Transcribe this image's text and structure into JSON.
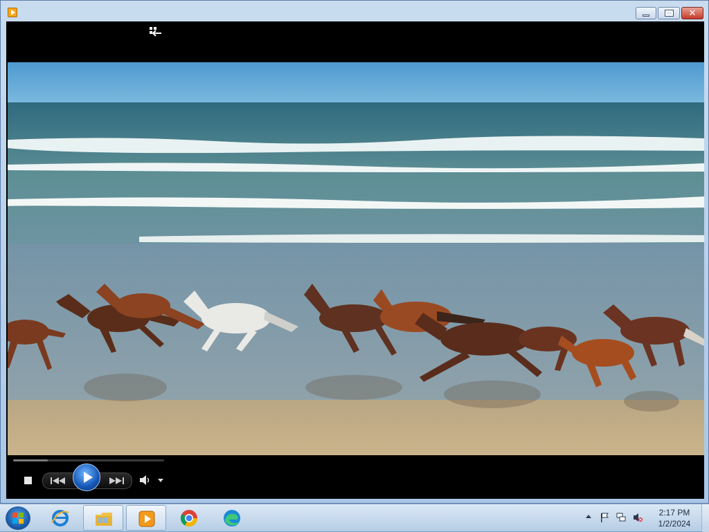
{
  "window": {
    "app_icon": "media-player-icon",
    "controls": [
      "minimize-icon",
      "maximize-icon",
      "close-icon"
    ]
  },
  "player": {
    "switch_to_library_icon": "switch-to-library-icon",
    "video_description_visible": "horses-running-on-beach",
    "progress": 0.23,
    "controls": {
      "stop_icon": "stop-icon",
      "previous_icon": "previous-icon",
      "play_icon": "play-icon",
      "next_icon": "next-icon",
      "mute_icon": "speaker-icon",
      "volume_dropdown_icon": "chevron-down-icon"
    }
  },
  "taskbar": {
    "start_icon": "windows-start-icon",
    "pinned": [
      {
        "name": "internet-explorer",
        "icon": "internet-explorer-icon",
        "active": false
      },
      {
        "name": "file-explorer",
        "icon": "folder-icon",
        "active": true
      },
      {
        "name": "media-player",
        "icon": "media-player-icon",
        "active": true
      },
      {
        "name": "chrome",
        "icon": "chrome-icon",
        "active": false
      },
      {
        "name": "edge",
        "icon": "edge-icon",
        "active": false
      }
    ],
    "tray": {
      "icons": [
        "show-hidden-icons-chevron",
        "action-center-flag-icon",
        "network-icon",
        "volume-muted-icon"
      ],
      "time": "2:17 PM",
      "date": "1/2/2024"
    }
  },
  "colors": {
    "title_bar": "#b9d1ea",
    "player_bg": "#000000",
    "taskbar": "#c9dbee",
    "accent": "#1556b6"
  }
}
